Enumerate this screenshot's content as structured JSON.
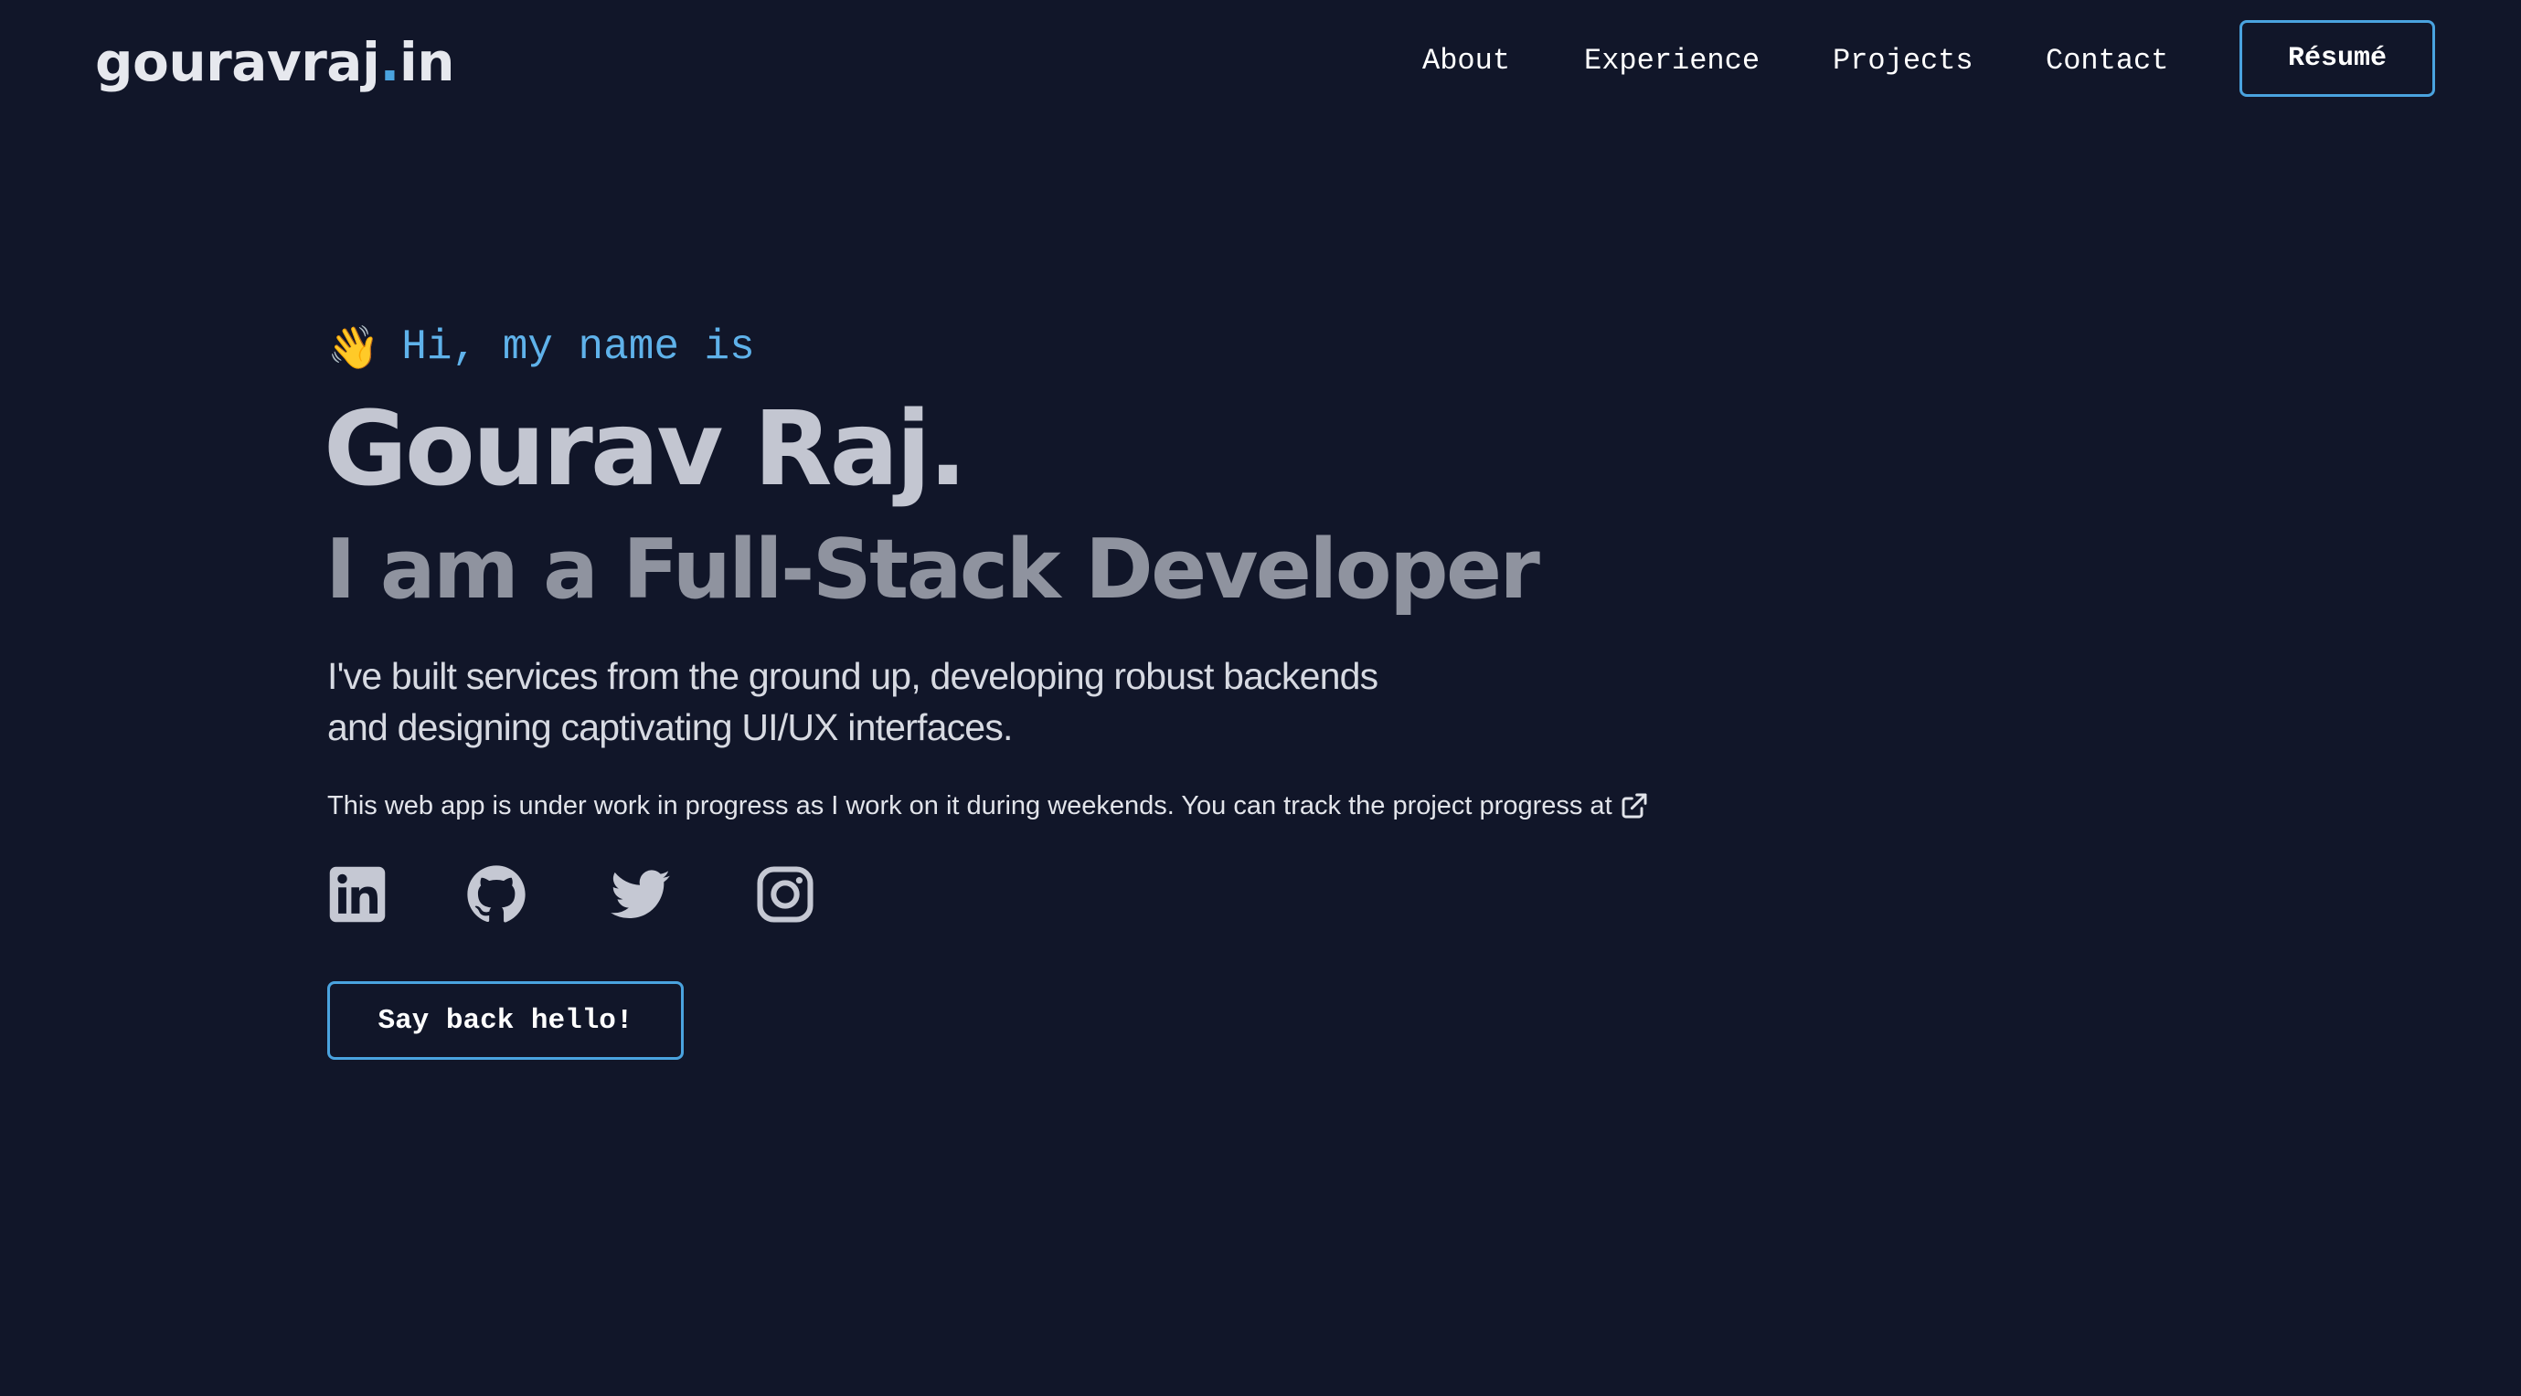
{
  "header": {
    "logo": {
      "name": "gouravraj",
      "dot": ".",
      "tld": "in"
    },
    "nav": [
      {
        "label": "About"
      },
      {
        "label": "Experience"
      },
      {
        "label": "Projects"
      },
      {
        "label": "Contact"
      }
    ],
    "resume_label": "Résumé"
  },
  "hero": {
    "greeting_icon": "waving-hand",
    "greeting_emoji": "👋",
    "greeting": "Hi, my name is",
    "name": "Gourav Raj.",
    "role": "I am a Full-Stack Developer",
    "description": [
      "I've built services from the ground up, developing robust backends",
      "and designing captivating UI/UX interfaces."
    ],
    "wip_text": "This web app is under work in progress as I work on it during weekends. You can track the project progress at",
    "wip_link_icon": "external-link-icon",
    "socials": [
      {
        "icon": "linkedin-icon"
      },
      {
        "icon": "github-icon"
      },
      {
        "icon": "twitter-icon"
      },
      {
        "icon": "instagram-icon"
      }
    ],
    "cta_label": "Say back hello!"
  },
  "colors": {
    "background": "#111629",
    "accent": "#4aa3df",
    "greeting": "#5fb2ea",
    "name": "#c3c6d1",
    "role": "#8f939f",
    "icon": "#c5c8d3"
  }
}
